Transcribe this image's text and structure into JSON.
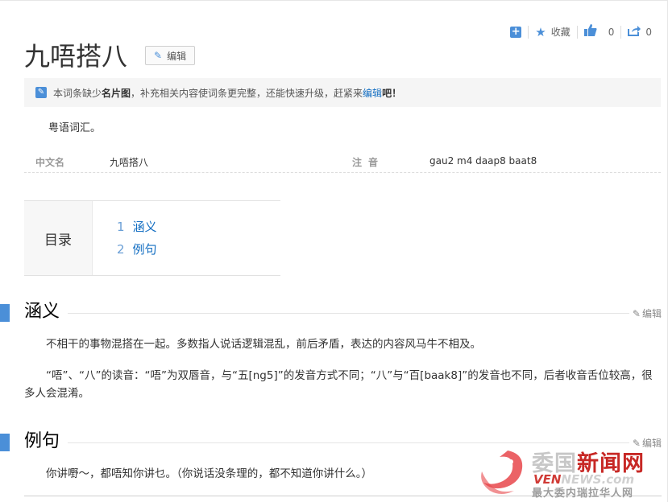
{
  "toolbar": {
    "favorite_label": "收藏",
    "like_count": "0",
    "share_count": "0"
  },
  "entry": {
    "title": "九唔搭八",
    "edit_label": "编辑"
  },
  "notice": {
    "prefix": "本词条缺少",
    "bold": "名片图",
    "middle": "，补充相关内容使词条更完整，还能快速升级，赶紧来",
    "link": "编辑",
    "suffix": "吧！"
  },
  "summary": "粤语词汇。",
  "basic_info": {
    "name_label": "中文名",
    "name_value": "九唔搭八",
    "pron_label": "注音",
    "pron_value": "gau2 m4 daap8 baat8"
  },
  "toc": {
    "label": "目录",
    "items": [
      {
        "num": "1",
        "text": "涵义"
      },
      {
        "num": "2",
        "text": "例句"
      }
    ]
  },
  "sections": [
    {
      "title": "涵义",
      "edit_label": "编辑",
      "paragraphs": [
        "不相干的事物混搭在一起。多数指人说话逻辑混乱，前后矛盾，表达的内容风马牛不相及。",
        "“唔”、“八”的读音：“唔”为双唇音，与“五[ng5]”的发音方式不同；“八”与“百[baak8]”的发音也不同，后者收音舌位较高，很多人会混淆。"
      ]
    },
    {
      "title": "例句",
      "edit_label": "编辑",
      "paragraphs": [
        "你讲嘢～，都唔知你讲乜。（你说话没条理的，都不知道你讲什么。）"
      ]
    }
  ],
  "watermark": {
    "title_a": "委国",
    "title_b": "新闻网",
    "url_a": "VEN",
    "url_b": "NEWS.com",
    "slogan": "最大委内瑞拉华人网"
  },
  "colors": {
    "accent": "#4b8fd8",
    "link": "#136ec2",
    "watermark_red": "#c72825"
  }
}
